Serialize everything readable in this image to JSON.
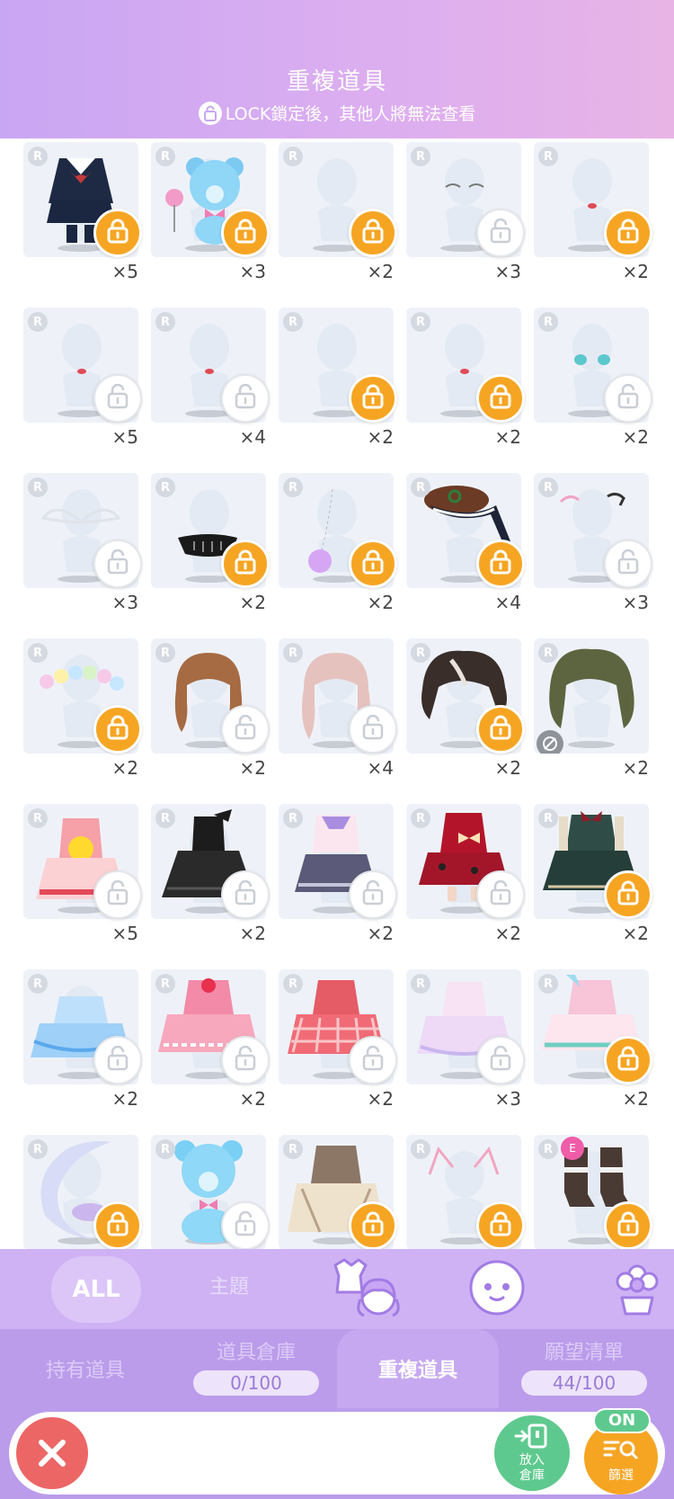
{
  "header": {
    "title": "重複道具",
    "subtitle": "LOCK鎖定後，其他人將無法查看"
  },
  "items": [
    {
      "rarity": "R",
      "count": "×5",
      "locked": true,
      "kind": "uniform"
    },
    {
      "rarity": "R",
      "count": "×3",
      "locked": true,
      "kind": "bear-blue"
    },
    {
      "rarity": "R",
      "count": "×2",
      "locked": true,
      "kind": "none"
    },
    {
      "rarity": "R",
      "count": "×3",
      "locked": false,
      "kind": "eyes-closed"
    },
    {
      "rarity": "R",
      "count": "×2",
      "locked": true,
      "kind": "lips"
    },
    {
      "rarity": "R",
      "count": "×5",
      "locked": false,
      "kind": "lips"
    },
    {
      "rarity": "R",
      "count": "×4",
      "locked": false,
      "kind": "lips"
    },
    {
      "rarity": "R",
      "count": "×2",
      "locked": true,
      "kind": "none"
    },
    {
      "rarity": "R",
      "count": "×2",
      "locked": true,
      "kind": "lips"
    },
    {
      "rarity": "R",
      "count": "×2",
      "locked": false,
      "kind": "eyes-teal"
    },
    {
      "rarity": "R",
      "count": "×3",
      "locked": false,
      "kind": "wings"
    },
    {
      "rarity": "R",
      "count": "×2",
      "locked": true,
      "kind": "mask"
    },
    {
      "rarity": "R",
      "count": "×2",
      "locked": true,
      "kind": "pompom"
    },
    {
      "rarity": "R",
      "count": "×4",
      "locked": true,
      "kind": "beret"
    },
    {
      "rarity": "R",
      "count": "×3",
      "locked": false,
      "kind": "ribbons"
    },
    {
      "rarity": "R",
      "count": "×2",
      "locked": true,
      "kind": "flower-crown"
    },
    {
      "rarity": "R",
      "count": "×2",
      "locked": false,
      "kind": "hair-brown"
    },
    {
      "rarity": "R",
      "count": "×4",
      "locked": false,
      "kind": "hair-pink"
    },
    {
      "rarity": "R",
      "count": "×2",
      "locked": true,
      "kind": "hair-dark"
    },
    {
      "rarity": "R",
      "count": "×2",
      "locked": null,
      "kind": "hair-green"
    },
    {
      "rarity": "R",
      "count": "×5",
      "locked": false,
      "kind": "dress-chick"
    },
    {
      "rarity": "R",
      "count": "×2",
      "locked": false,
      "kind": "dress-black"
    },
    {
      "rarity": "R",
      "count": "×2",
      "locked": false,
      "kind": "dress-sailor"
    },
    {
      "rarity": "R",
      "count": "×2",
      "locked": false,
      "kind": "dress-red"
    },
    {
      "rarity": "R",
      "count": "×2",
      "locked": true,
      "kind": "dress-green"
    },
    {
      "rarity": "R",
      "count": "×2",
      "locked": false,
      "kind": "dress-blue"
    },
    {
      "rarity": "R",
      "count": "×2",
      "locked": false,
      "kind": "dress-pink"
    },
    {
      "rarity": "R",
      "count": "×2",
      "locked": false,
      "kind": "dress-gingham"
    },
    {
      "rarity": "R",
      "count": "×3",
      "locked": false,
      "kind": "dress-pastel"
    },
    {
      "rarity": "R",
      "count": "×2",
      "locked": true,
      "kind": "dress-mint"
    },
    {
      "rarity": "R",
      "count": "",
      "locked": true,
      "kind": "moon"
    },
    {
      "rarity": "R",
      "count": "",
      "locked": false,
      "kind": "bear-full"
    },
    {
      "rarity": "R",
      "count": "",
      "locked": true,
      "kind": "dress-tan"
    },
    {
      "rarity": "R",
      "count": "",
      "locked": true,
      "kind": "cat-ears"
    },
    {
      "rarity": "R",
      "count": "",
      "locked": true,
      "kind": "boots"
    }
  ],
  "category_bar": {
    "all_label": "ALL",
    "theme_label": "主題",
    "icons": [
      "outfit-hair-icon",
      "face-icon",
      "flower-pot-icon"
    ]
  },
  "tabs": [
    {
      "label": "持有道具",
      "pill": ""
    },
    {
      "label": "道具倉庫",
      "pill": "0/100"
    },
    {
      "label": "重複道具",
      "pill": ""
    },
    {
      "label": "願望清單",
      "pill": "44/100"
    }
  ],
  "actions": {
    "store_label_1": "放入",
    "store_label_2": "倉庫",
    "filter_label": "篩選",
    "on_badge": "ON"
  },
  "colors": {
    "accent_orange": "#f6a523",
    "header_purple": "#c9a6f3",
    "tab_purple": "#bb9ceb",
    "green": "#5ec98e",
    "red": "#ec6666"
  }
}
